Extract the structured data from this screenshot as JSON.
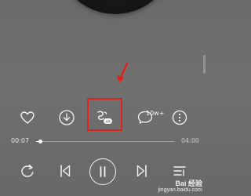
{
  "player": {
    "comment_count": "10w+",
    "current_time": "00:07",
    "total_time": "04:00",
    "progress": 0.03
  },
  "icons": {
    "like": "heart-icon",
    "download": "download-icon",
    "effect": "sound-effect-off-icon",
    "comment": "comment-icon",
    "more": "more-icon",
    "mode": "repeat-icon",
    "prev": "previous-icon",
    "play": "pause-icon",
    "next": "next-icon",
    "playlist": "playlist-icon"
  },
  "badge": {
    "effect_state": "off"
  },
  "annotation": {
    "color": "#e0211c"
  },
  "watermark": {
    "line1": "Bai 经验",
    "line2": "jingyan.baidu.com"
  }
}
